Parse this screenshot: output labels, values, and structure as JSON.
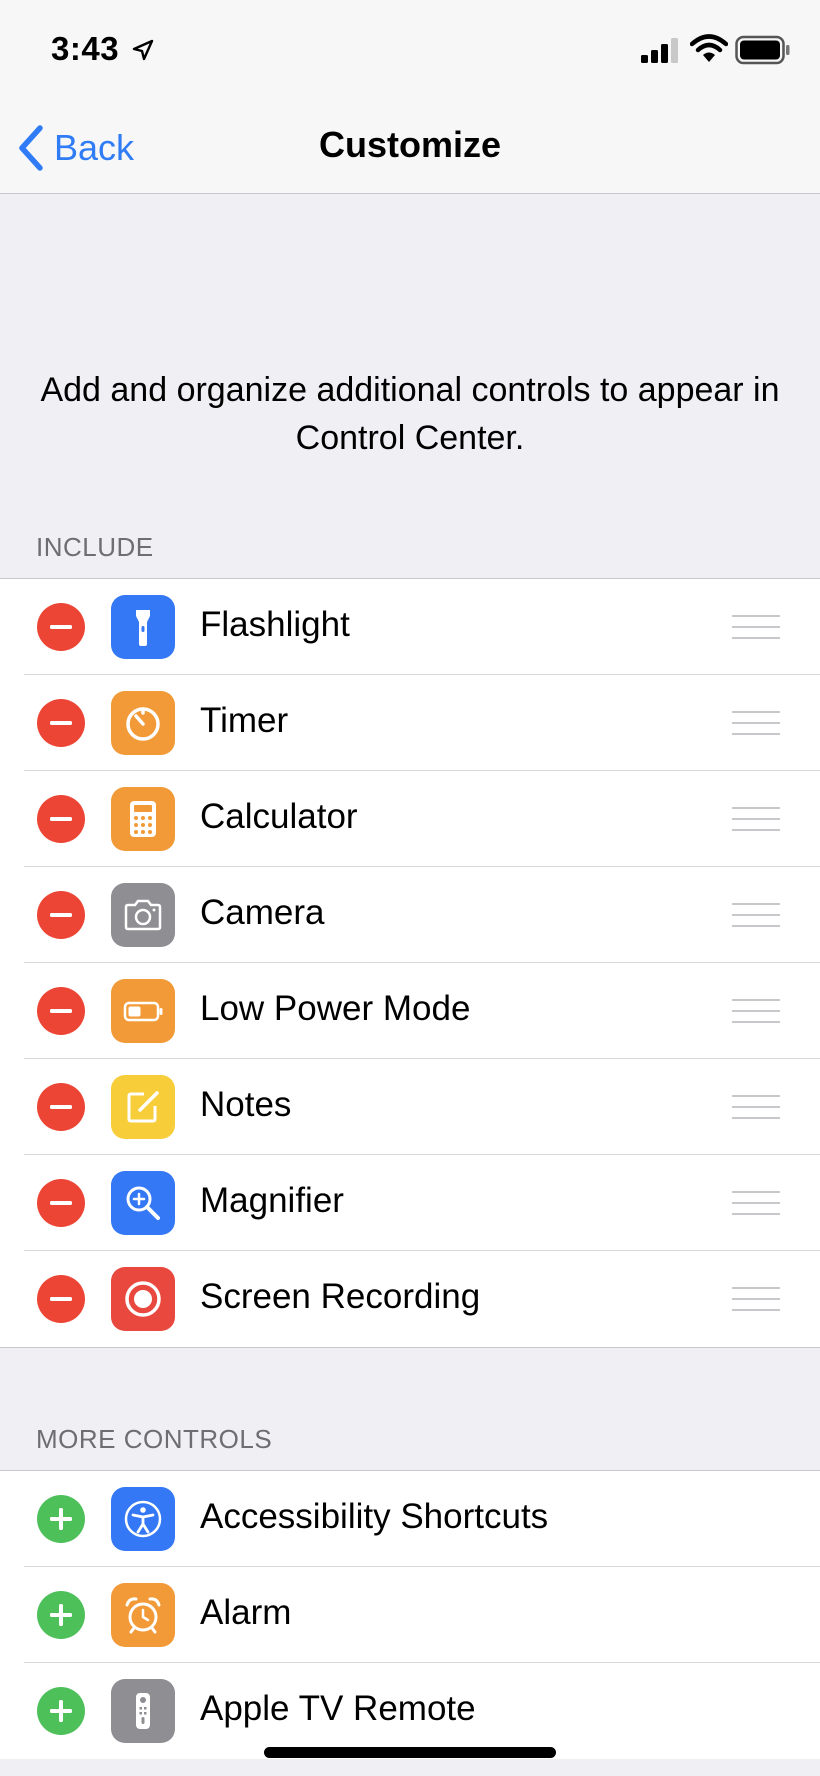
{
  "status_bar": {
    "time": "3:43",
    "icons": [
      "location-arrow-icon",
      "cellular-signal-icon",
      "wifi-icon",
      "battery-icon"
    ]
  },
  "nav": {
    "back_label": "Back",
    "title": "Customize"
  },
  "description": "Add and organize additional controls to appear in Control Center.",
  "include": {
    "header": "INCLUDE",
    "items": [
      {
        "label": "Flashlight",
        "icon": "flashlight-icon",
        "color": "#3478f6"
      },
      {
        "label": "Timer",
        "icon": "timer-icon",
        "color": "#f19a37"
      },
      {
        "label": "Calculator",
        "icon": "calculator-icon",
        "color": "#f19a37"
      },
      {
        "label": "Camera",
        "icon": "camera-icon",
        "color": "#8e8e93"
      },
      {
        "label": "Low Power Mode",
        "icon": "battery-low-icon",
        "color": "#f19a37"
      },
      {
        "label": "Notes",
        "icon": "notes-icon",
        "color": "#f7cd3a"
      },
      {
        "label": "Magnifier",
        "icon": "magnifier-icon",
        "color": "#3478f6"
      },
      {
        "label": "Screen Recording",
        "icon": "record-icon",
        "color": "#e8483d"
      }
    ]
  },
  "more_controls": {
    "header": "MORE CONTROLS",
    "items": [
      {
        "label": "Accessibility Shortcuts",
        "icon": "accessibility-icon",
        "color": "#3478f6"
      },
      {
        "label": "Alarm",
        "icon": "alarm-clock-icon",
        "color": "#f19a37"
      },
      {
        "label": "Apple TV Remote",
        "icon": "tv-remote-icon",
        "color": "#8e8e93"
      }
    ]
  },
  "colors": {
    "accent": "#2f7cf6",
    "remove": "#ec4535",
    "add": "#4ec05a",
    "background": "#efeff4"
  }
}
